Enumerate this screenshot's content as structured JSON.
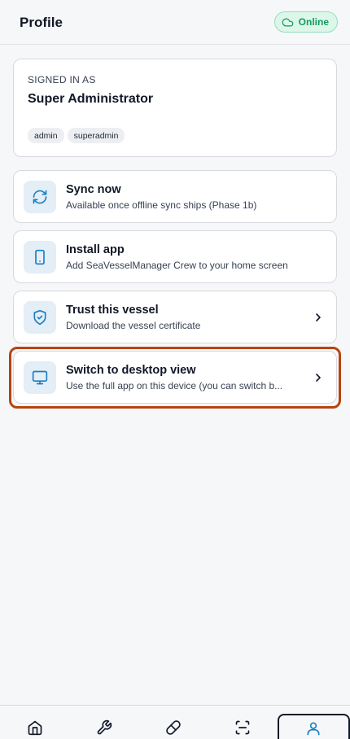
{
  "header": {
    "title": "Profile",
    "status": "Online"
  },
  "signed_in": {
    "eyebrow": "SIGNED IN AS",
    "name": "Super Administrator",
    "roles": [
      "admin",
      "superadmin"
    ]
  },
  "actions": [
    {
      "title": "Sync now",
      "subtitle": "Available once offline sync ships (Phase 1b)",
      "icon": "refresh-icon",
      "has_chevron": false
    },
    {
      "title": "Install app",
      "subtitle": "Add SeaVesselManager Crew to your home screen",
      "icon": "phone-icon",
      "has_chevron": false
    },
    {
      "title": "Trust this vessel",
      "subtitle": "Download the vessel certificate",
      "icon": "shield-check-icon",
      "has_chevron": true
    },
    {
      "title": "Switch to desktop view",
      "subtitle": "Use the full app on this device (you can switch b...",
      "icon": "monitor-icon",
      "has_chevron": true
    }
  ],
  "bottom_nav": [
    {
      "icon": "home-icon",
      "active": false
    },
    {
      "icon": "wrench-icon",
      "active": false
    },
    {
      "icon": "pill-icon",
      "active": false
    },
    {
      "icon": "scan-icon",
      "active": false
    },
    {
      "icon": "user-icon",
      "active": true
    }
  ],
  "colors": {
    "accent": "#1b7fbf",
    "online_bg": "#dcf7ea",
    "online_text": "#14995e",
    "highlight": "#b8440f",
    "icon_tile": "#e3eef7"
  }
}
